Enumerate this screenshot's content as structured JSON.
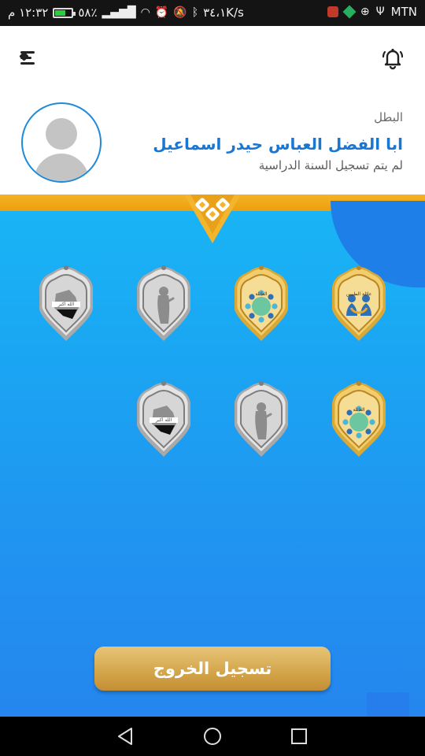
{
  "status_bar": {
    "time": "١٢:٣٢ م",
    "battery": "٥٨٪",
    "speed": "٣٤،١K/s",
    "carrier": "MTN"
  },
  "app_bar": {
    "menu_icon": "menu-collapse-icon",
    "notification_icon": "bell-ringing-icon"
  },
  "profile": {
    "role": "البطل",
    "name": "ابا الفضل العباس حيدر اسماعيل",
    "status": "لم يتم تسجيل السنة الدراسية",
    "avatar_icon": "default-user-avatar"
  },
  "badges": [
    {
      "id": "badge-family-gold",
      "color": "gold",
      "unlocked": true,
      "emblem": "family",
      "caption": "عائلة الطيبين"
    },
    {
      "id": "badge-community-gold",
      "color": "gold",
      "unlocked": true,
      "emblem": "community",
      "caption": "العائلة"
    },
    {
      "id": "badge-prayer-silver",
      "color": "silver",
      "unlocked": false,
      "emblem": "prayer"
    },
    {
      "id": "badge-iraq-map-silver",
      "color": "silver",
      "unlocked": false,
      "emblem": "iraq-map",
      "caption": "الله اكبر"
    },
    {
      "id": "badge-community-gold-2",
      "color": "gold",
      "unlocked": true,
      "emblem": "community",
      "caption": "العائلة"
    },
    {
      "id": "badge-prayer-silver-2",
      "color": "silver",
      "unlocked": false,
      "emblem": "prayer"
    },
    {
      "id": "badge-iraq-map-silver-2",
      "color": "silver",
      "unlocked": false,
      "emblem": "iraq-map",
      "caption": "الله اكبر"
    }
  ],
  "logout_label": "تسجيل الخروج",
  "colors": {
    "primary_blue": "#1976d2",
    "gold": "#d3a449",
    "band": "#f4b324",
    "background_top": "#19b6f5",
    "background_bottom": "#2486ee"
  },
  "nav": [
    "back-icon",
    "home-icon",
    "recents-icon"
  ]
}
